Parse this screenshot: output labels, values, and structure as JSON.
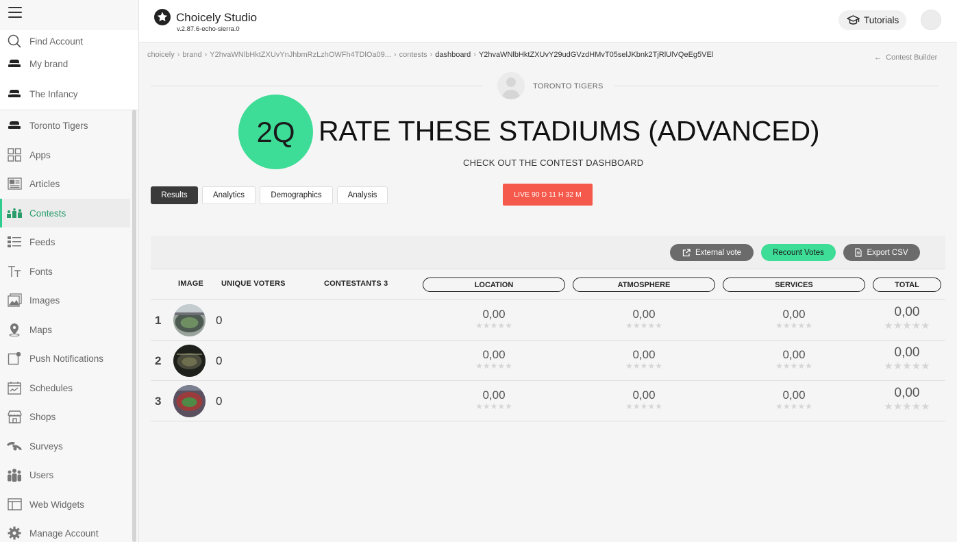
{
  "sidebar": {
    "top": [
      {
        "label": "Find Account",
        "icon": "search-icon"
      },
      {
        "label": "My brand",
        "icon": "brand-hat-icon"
      },
      {
        "label": "The Infancy",
        "icon": "brand-hat-icon"
      }
    ],
    "items": [
      {
        "label": "Toronto Tigers",
        "icon": "brand-hat-icon"
      },
      {
        "label": "Apps",
        "icon": "apps-grid-icon"
      },
      {
        "label": "Articles",
        "icon": "articles-icon"
      },
      {
        "label": "Contests",
        "icon": "contests-icon"
      },
      {
        "label": "Feeds",
        "icon": "feeds-icon"
      },
      {
        "label": "Fonts",
        "icon": "fonts-icon"
      },
      {
        "label": "Images",
        "icon": "images-icon"
      },
      {
        "label": "Maps",
        "icon": "map-pin-icon"
      },
      {
        "label": "Push Notifications",
        "icon": "push-notification-icon"
      },
      {
        "label": "Schedules",
        "icon": "calendar-icon"
      },
      {
        "label": "Shops",
        "icon": "shop-icon"
      },
      {
        "label": "Surveys",
        "icon": "surveys-icon"
      },
      {
        "label": "Users",
        "icon": "users-icon"
      },
      {
        "label": "Web Widgets",
        "icon": "widget-icon"
      },
      {
        "label": "Manage Account",
        "icon": "gear-icon"
      }
    ]
  },
  "header": {
    "title": "Choicely Studio",
    "version": "v.2.87.6-echo-sierra.0",
    "tutorials_label": "Tutorials"
  },
  "breadcrumb": {
    "items": [
      "choicely",
      "brand",
      "Y2hvaWNlbHktZXUvYnJhbmRzLzhOWFh4TDlOa09...",
      "contests",
      "dashboard",
      "Y2hvaWNlbHktZXUvY29udGVzdHMvT05selJKbnk2TjRlUlVQeEg5VEl"
    ],
    "back_label": "Contest Builder"
  },
  "brand": {
    "name": "TORONTO TIGERS"
  },
  "contest": {
    "badge": "2Q",
    "title": "RATE THESE STADIUMS (ADVANCED)",
    "subtitle": "CHECK OUT THE CONTEST DASHBOARD",
    "live_status": "LIVE  90 D 11 H 32 M"
  },
  "tabs": [
    "Results",
    "Analytics",
    "Demographics",
    "Analysis"
  ],
  "toolbar": {
    "external_vote": "External vote",
    "recount_votes": "Recount Votes",
    "export_csv": "Export CSV"
  },
  "table": {
    "headers": {
      "image": "IMAGE",
      "unique_voters": "UNIQUE VOTERS",
      "contestants": "CONTESTANTS 3",
      "location": "LOCATION",
      "atmosphere": "ATMOSPHERE",
      "services": "SERVICES",
      "total": "TOTAL"
    },
    "rows": [
      {
        "rank": "1",
        "voters": "0",
        "location": "0,00",
        "atmosphere": "0,00",
        "services": "0,00",
        "total": "0,00",
        "stars": "★★★★★"
      },
      {
        "rank": "2",
        "voters": "0",
        "location": "0,00",
        "atmosphere": "0,00",
        "services": "0,00",
        "total": "0,00",
        "stars": "★★★★★"
      },
      {
        "rank": "3",
        "voters": "0",
        "location": "0,00",
        "atmosphere": "0,00",
        "services": "0,00",
        "total": "0,00",
        "stars": "★★★★★"
      }
    ]
  },
  "colors": {
    "accent_green": "#3ddc97",
    "live_red": "#f5594b",
    "active_tab": "#3a3a3a"
  }
}
